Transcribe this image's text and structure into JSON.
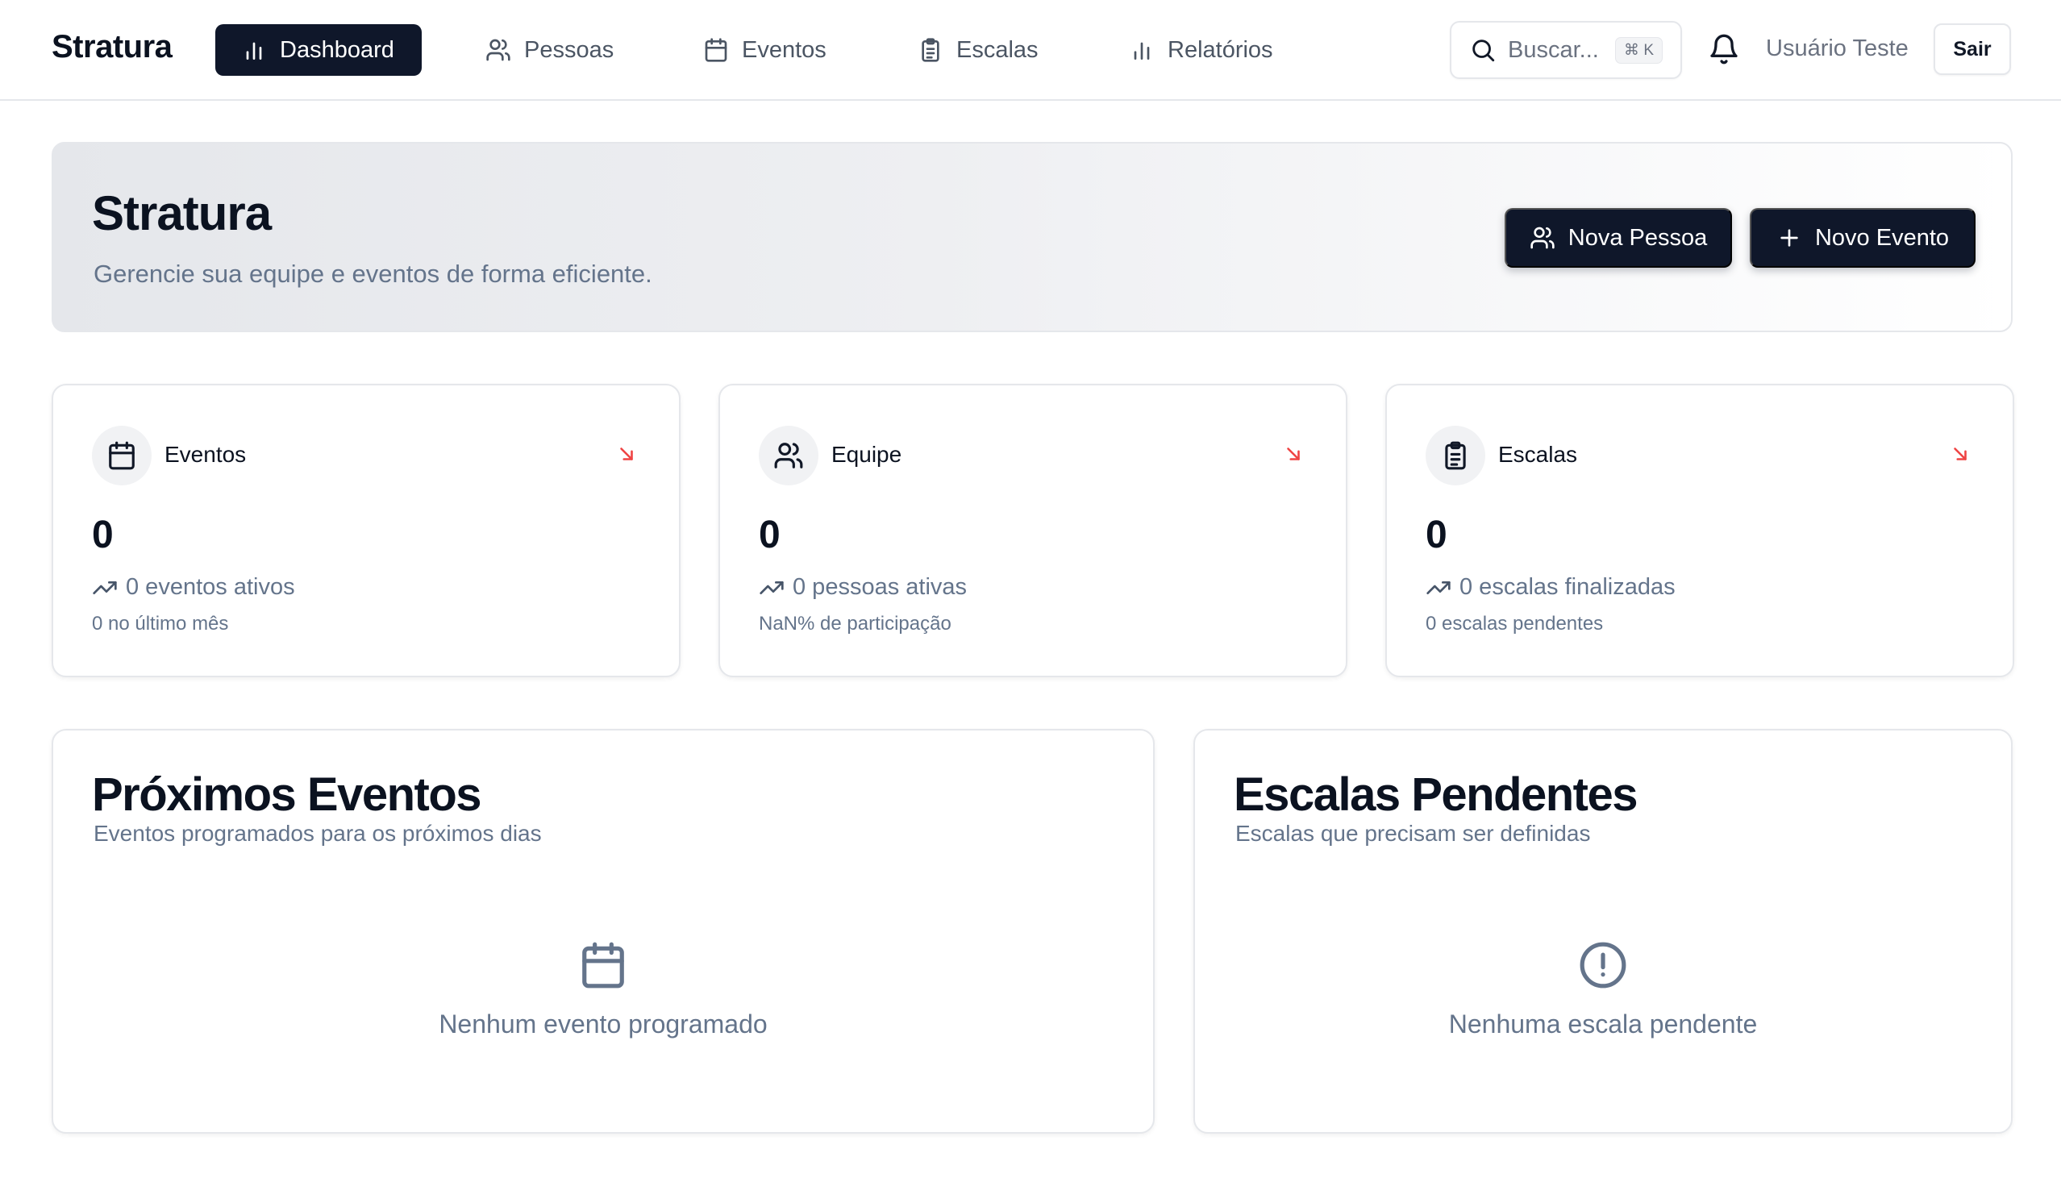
{
  "app": {
    "brand": "Stratura",
    "nav": [
      {
        "label": "Dashboard",
        "icon": "bar-chart-icon"
      },
      {
        "label": "Pessoas",
        "icon": "users-icon"
      },
      {
        "label": "Eventos",
        "icon": "calendar-icon"
      },
      {
        "label": "Escalas",
        "icon": "clipboard-icon"
      },
      {
        "label": "Relatórios",
        "icon": "bar-chart-icon"
      }
    ],
    "active_nav": "Dashboard",
    "search": {
      "placeholder": "Buscar...",
      "shortcut": "⌘ K"
    },
    "user": {
      "name": "Usuário Teste"
    },
    "logout_label": "Sair"
  },
  "hero": {
    "title": "Stratura",
    "subtitle": "Gerencie sua equipe e eventos de forma eficiente.",
    "buttons": {
      "new_person": "Nova Pessoa",
      "new_event": "Novo Evento"
    }
  },
  "stats": [
    {
      "label": "Eventos",
      "value": "0",
      "detail": "0 eventos ativos",
      "note": "0 no último mês",
      "icon": "calendar-icon",
      "trend": "down"
    },
    {
      "label": "Equipe",
      "value": "0",
      "detail": "0 pessoas ativas",
      "note": "NaN% de participação",
      "icon": "users-icon",
      "trend": "down"
    },
    {
      "label": "Escalas",
      "value": "0",
      "detail": "0 escalas finalizadas",
      "note": "0 escalas pendentes",
      "icon": "clipboard-icon",
      "trend": "down"
    }
  ],
  "panels": {
    "upcoming_events": {
      "title": "Próximos Eventos",
      "subtitle": "Eventos programados para os próximos dias",
      "empty_text": "Nenhum evento programado",
      "empty_icon": "calendar-icon"
    },
    "pending_scales": {
      "title": "Escalas Pendentes",
      "subtitle": "Escalas que precisam ser definidas",
      "empty_text": "Nenhuma escala pendente",
      "empty_icon": "alert-circle-icon"
    }
  },
  "colors": {
    "primary": "#0f172a",
    "muted_text": "#64748b",
    "border": "#e5e7eb",
    "trend_down": "#ef4444"
  }
}
